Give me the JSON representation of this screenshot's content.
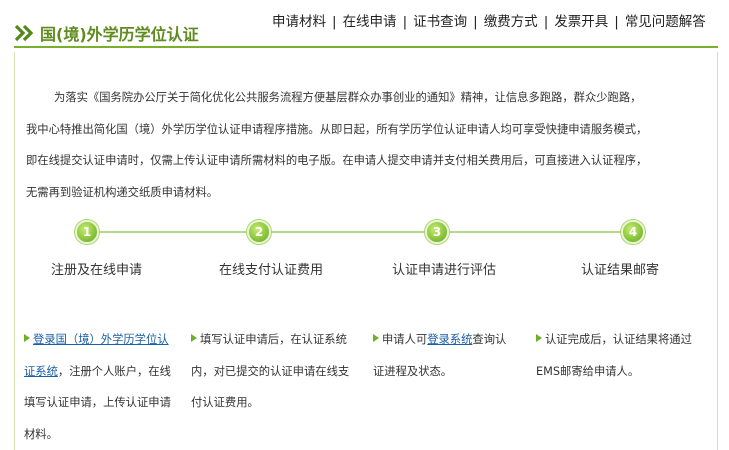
{
  "header": {
    "logo_text": "国(境)外学历学位认证"
  },
  "nav": {
    "items": [
      {
        "label": "申请材料"
      },
      {
        "label": "在线申请"
      },
      {
        "label": "证书查询"
      },
      {
        "label": "缴费方式"
      },
      {
        "label": "发票开具"
      },
      {
        "label": "常见问题解答"
      }
    ],
    "separator": "|"
  },
  "intro": {
    "lines": [
      "为落实《国务院办公厅关于简化优化公共服务流程方便基层群众办事创业的通知》精神，让信息多跑路，群众少跑路，",
      "我中心特推出简化国（境）外学历学位认证申请程序措施。从即日起，所有学历学位认证申请人均可享受快捷申请服务模式，",
      "即在线提交认证申请时，仅需上传认证申请所需材料的电子版。在申请人提交申请并支付相关费用后，可直接进入认证程序，",
      "无需再到验证机构递交纸质申请材料。"
    ]
  },
  "steps": [
    {
      "number": "1",
      "label": "注册及在线申请"
    },
    {
      "number": "2",
      "label": "在线支付认证费用"
    },
    {
      "number": "3",
      "label": "认证申请进行评估"
    },
    {
      "number": "4",
      "label": "认证结果邮寄"
    }
  ],
  "descriptions": {
    "d1": {
      "link": "登录国（境）外学历学位认证系统",
      "line1_link": "登录国（境）外学历学位认",
      "line2_link": "证系统",
      "line2_rest": "，注册个人账户，在线",
      "line3": "填写认证申请，上传认证申请",
      "line4": "材料。"
    },
    "d2": {
      "line1": "填写认证申请后，在认证系统",
      "line2": "内，对已提交的认证申请在线支",
      "line3": "付认证费用。"
    },
    "d3": {
      "line1_pre": "申请人可",
      "line1_link": "登录系统",
      "line1_post": "查询认",
      "line2": "证进程及状态。"
    },
    "d4": {
      "line1": "认证完成后，认证结果将通过",
      "line2": "EMS邮寄给申请人。"
    }
  },
  "colors": {
    "brand_green": "#5f8c1e",
    "line_green": "#79b02a",
    "link_blue": "#1a5fa8"
  }
}
